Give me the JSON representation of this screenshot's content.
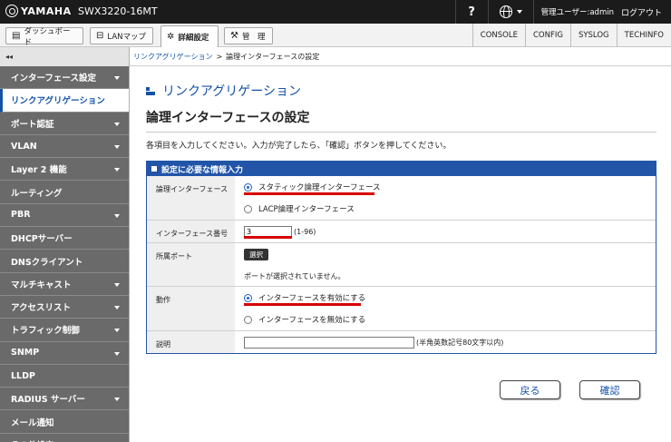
{
  "topbar": {
    "brand": "YAMAHA",
    "model": "SWX3220-16MT",
    "help": "?",
    "user": "管理ユーザー:admin",
    "logout": "ログアウト"
  },
  "nav": {
    "tabs": [
      {
        "label": "ダッシュボード",
        "icon": "dashboard-icon"
      },
      {
        "label": "LANマップ",
        "icon": "lan-map-icon"
      },
      {
        "label": "詳細設定",
        "icon": "gear-icon"
      },
      {
        "label": "管　理",
        "icon": "wrench-icon"
      }
    ],
    "links": [
      "CONSOLE",
      "CONFIG",
      "SYSLOG",
      "TECHINFO"
    ]
  },
  "sidebar": {
    "collapse": "◂◂",
    "items": [
      {
        "label": "インターフェース設定",
        "has_caret": true
      },
      {
        "label": "リンクアグリゲーション",
        "selected": true
      },
      {
        "label": "ポート認証",
        "has_caret": true
      },
      {
        "label": "VLAN",
        "has_caret": true
      },
      {
        "label": "Layer 2 機能",
        "has_caret": true
      },
      {
        "label": "ルーティング",
        "has_caret": false
      },
      {
        "label": "PBR",
        "has_caret": true
      },
      {
        "label": "DHCPサーバー",
        "has_caret": false
      },
      {
        "label": "DNSクライアント",
        "has_caret": false
      },
      {
        "label": "マルチキャスト",
        "has_caret": true
      },
      {
        "label": "アクセスリスト",
        "has_caret": true
      },
      {
        "label": "トラフィック制御",
        "has_caret": true
      },
      {
        "label": "SNMP",
        "has_caret": true
      },
      {
        "label": "LLDP",
        "has_caret": false
      },
      {
        "label": "RADIUS サーバー",
        "has_caret": true
      },
      {
        "label": "メール通知",
        "has_caret": false
      },
      {
        "label": "その他設定",
        "has_caret": true
      }
    ]
  },
  "breadcrumb": {
    "link": "リンクアグリゲーション",
    "separator": ">",
    "current": "論理インターフェースの設定"
  },
  "main": {
    "section_title": "リンクアグリゲーション",
    "page_title": "論理インターフェースの設定",
    "intro": "各項目を入力してください。入力が完了したら、「確認」ボタンを押してください。"
  },
  "form": {
    "header": "設定に必要な情報入力",
    "interface_label": "論理インターフェース",
    "interface_options": [
      "スタティック論理インターフェース",
      "LACP論理インターフェース"
    ],
    "interface_selected": 0,
    "number_label": "インターフェース番号",
    "number_value": "3",
    "number_hint": "(1-96)",
    "ports_label": "所属ポート",
    "select_button": "選択",
    "ports_status": "ポートが選択されていません。",
    "action_label": "動作",
    "action_options": [
      "インターフェースを有効にする",
      "インターフェースを無効にする"
    ],
    "action_selected": 0,
    "description_label": "説明",
    "description_value": "",
    "description_hint": "(半角英数記号80文字以内)"
  },
  "buttons": {
    "back": "戻る",
    "confirm": "確認"
  },
  "colors": {
    "accent": "#1552a8",
    "sidebar_item": "#6a6a6a",
    "highlight_underline": "#d60000",
    "topbar": "#1b1b1b"
  }
}
